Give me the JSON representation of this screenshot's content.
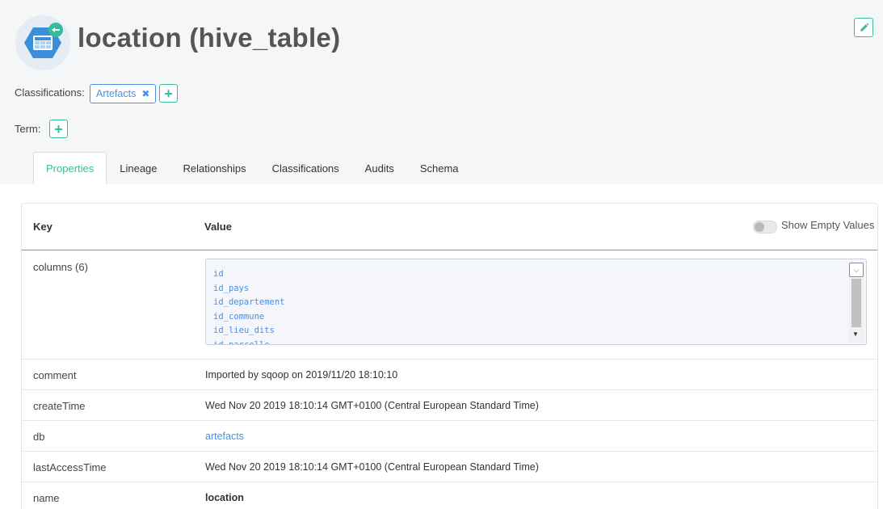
{
  "entity": {
    "title": "location (hive_table)",
    "icon": "hive-table-icon",
    "edit_icon": "pencil-icon"
  },
  "classifications": {
    "label": "Classifications:",
    "tags": [
      {
        "name": "Artefacts",
        "remove_icon": "close-icon"
      }
    ],
    "add_icon": "plus-icon"
  },
  "term": {
    "label": "Term:",
    "add_icon": "plus-icon"
  },
  "tabs": [
    {
      "label": "Properties",
      "active": true
    },
    {
      "label": "Lineage",
      "active": false
    },
    {
      "label": "Relationships",
      "active": false
    },
    {
      "label": "Classifications",
      "active": false
    },
    {
      "label": "Audits",
      "active": false
    },
    {
      "label": "Schema",
      "active": false
    }
  ],
  "table": {
    "key_header": "Key",
    "value_header": "Value",
    "show_empty_label": "Show Empty Values",
    "show_empty_enabled": false,
    "rows": [
      {
        "key": "columns (6)",
        "values": [
          "id",
          "id_pays",
          "id_departement",
          "id_commune",
          "id_lieu_dits",
          "id_parcelle"
        ]
      },
      {
        "key": "comment",
        "value": "Imported by sqoop on 2019/11/20 18:10:10"
      },
      {
        "key": "createTime",
        "value": "Wed Nov 20 2019 18:10:14 GMT+0100 (Central European Standard Time)"
      },
      {
        "key": "db",
        "value": "artefacts"
      },
      {
        "key": "lastAccessTime",
        "value": "Wed Nov 20 2019 18:10:14 GMT+0100 (Central European Standard Time)"
      },
      {
        "key": "name",
        "value": "location"
      }
    ]
  },
  "colors": {
    "accent": "#37bb9b",
    "link": "#4a90e2",
    "header_bg": "#f5f6f8",
    "icon_blue": "#3b8fd9"
  }
}
